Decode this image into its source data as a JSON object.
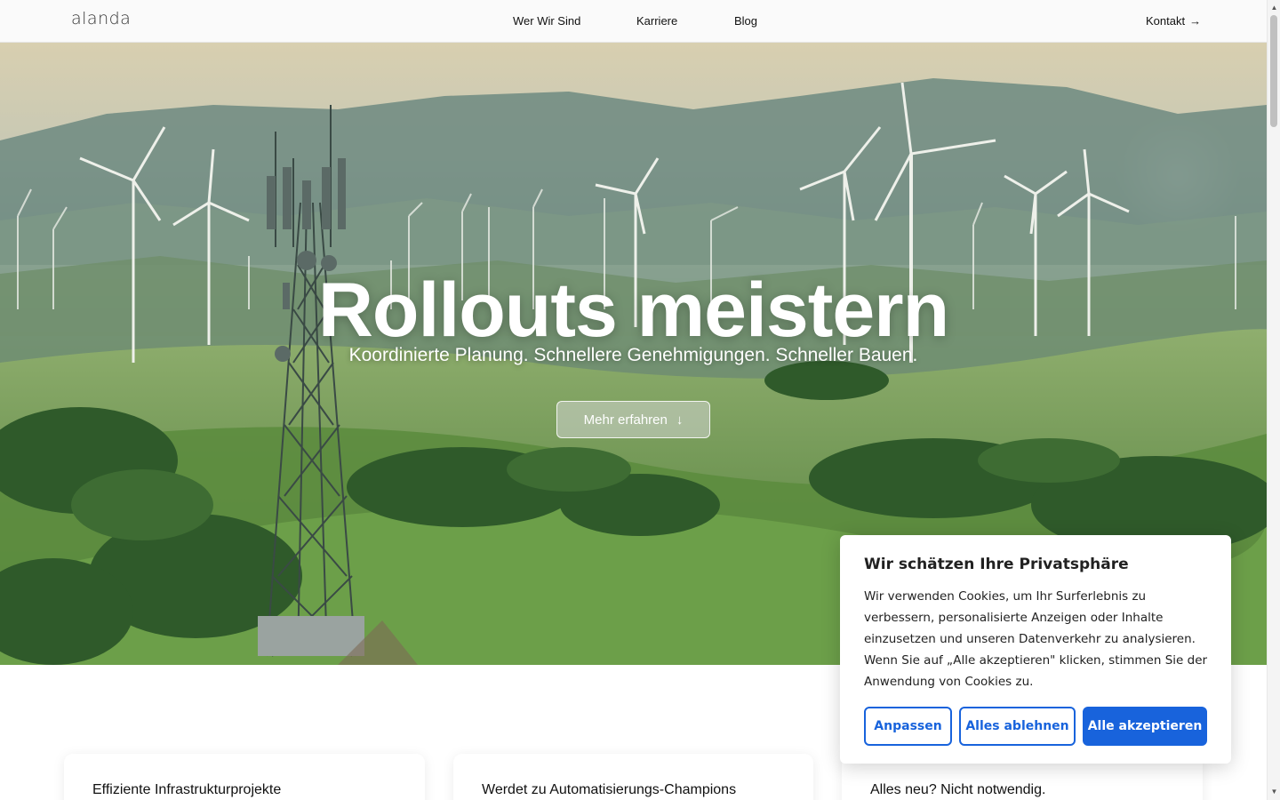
{
  "header": {
    "logo": "alanda",
    "nav": [
      "Wer Wir Sind",
      "Karriere",
      "Blog"
    ],
    "contact_label": "Kontakt"
  },
  "hero": {
    "title": "Rollouts meistern",
    "subtitle": "Koordinierte Planung. Schnellere Genehmigungen. Schneller Bauen.",
    "button_label": "Mehr erfahren"
  },
  "cards": [
    {
      "title": "Effiziente Infrastrukturprojekte"
    },
    {
      "title": "Werdet zu Automatisierungs-Champions"
    },
    {
      "title": "Alles neu? Nicht notwendig."
    }
  ],
  "cookie": {
    "title": "Wir schätzen Ihre Privatsphäre",
    "text": "Wir verwenden Cookies, um Ihr Surferlebnis zu verbessern, personalisierte Anzeigen oder Inhalte einzusetzen und unseren Datenverkehr zu analysieren. Wenn Sie auf „Alle akzeptieren\" klicken, stimmen Sie der Anwendung von Cookies zu.",
    "customize_label": "Anpassen",
    "reject_label": "Alles ablehnen",
    "accept_label": "Alle akzeptieren"
  },
  "colors": {
    "accent": "#1863dc",
    "header_bg": "#fafafa"
  }
}
